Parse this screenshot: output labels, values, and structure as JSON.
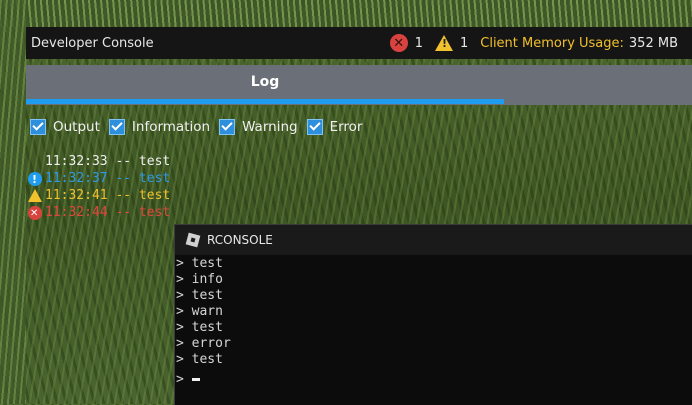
{
  "devconsole": {
    "title": "Developer Console",
    "error_count": "1",
    "warning_count": "1",
    "memory_label": "Client Memory Usage:",
    "memory_value": "352 MB",
    "tab_label": "Log",
    "filters": [
      {
        "label": "Output",
        "checked": true
      },
      {
        "label": "Information",
        "checked": true
      },
      {
        "label": "Warning",
        "checked": true
      },
      {
        "label": "Error",
        "checked": true
      }
    ],
    "log": [
      {
        "level": "output",
        "text": "11:32:33 -- test"
      },
      {
        "level": "info",
        "text": "11:32:37 -- test"
      },
      {
        "level": "warning",
        "text": "11:32:41 -- test"
      },
      {
        "level": "error",
        "text": "11:32:44 -- test"
      }
    ]
  },
  "rconsole": {
    "title": "RCONSOLE",
    "lines": [
      "> test",
      "> info",
      "> test",
      "> warn",
      "> test",
      "> error",
      "> test"
    ],
    "prompt": "> "
  },
  "colors": {
    "accent": "#1e9cf0",
    "warning": "#f2c12e",
    "error": "#d9433f",
    "info": "#2c9be8"
  }
}
